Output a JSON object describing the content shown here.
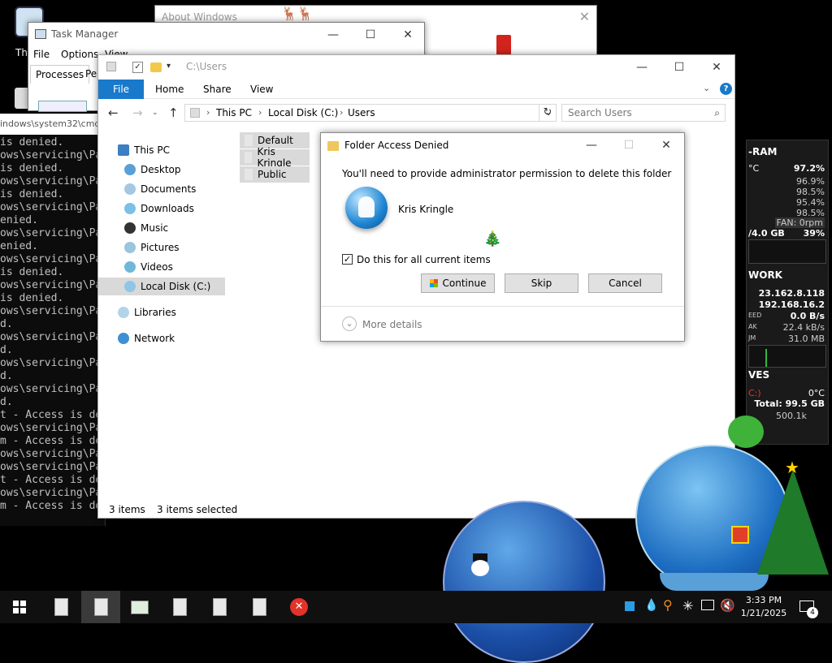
{
  "desktop": {
    "icon_label_partial": "Th"
  },
  "about": {
    "title": "About Windows"
  },
  "taskmgr": {
    "title": "Task Manager",
    "menus": [
      "File",
      "Options",
      "View"
    ],
    "tab_processes": "Processes",
    "tab_partial": "Pe"
  },
  "cmd": {
    "title_partial": "indows\\system32\\cmd",
    "lines": [
      "is denied.",
      "ows\\servicing\\Pa",
      "is denied.",
      "ows\\servicing\\Pa",
      "is denied.",
      "ows\\servicing\\Pa",
      "enied.",
      "ows\\servicing\\Pa",
      "enied.",
      "ows\\servicing\\Pa",
      "is denied.",
      "ows\\servicing\\Pa",
      "is denied.",
      "ows\\servicing\\Pa",
      "d.",
      "ows\\servicing\\Pa",
      "d.",
      "ows\\servicing\\Pa",
      "d.",
      "ows\\servicing\\Pa",
      "d.",
      "t - Access is de",
      "ows\\servicing\\Pa",
      "m - Access is de",
      "ows\\servicing\\Pa",
      "ows\\servicing\\Pa",
      "t - Access is de",
      "ows\\servicing\\Pa",
      "m - Access is de"
    ]
  },
  "explorer": {
    "path_title": "C:\\Users",
    "ribbon_tabs": [
      "File",
      "Home",
      "Share",
      "View"
    ],
    "breadcrumb": [
      "This PC",
      "Local Disk (C:)",
      "Users"
    ],
    "search_placeholder": "Search Users",
    "nav": [
      "This PC",
      "Desktop",
      "Documents",
      "Downloads",
      "Music",
      "Pictures",
      "Videos",
      "Local Disk (C:)",
      "Libraries",
      "Network"
    ],
    "files": [
      "Default",
      "Kris Kringle",
      "Public"
    ],
    "status_count": "3 items",
    "status_selected": "3 items selected"
  },
  "dialog": {
    "title": "Folder Access Denied",
    "message": "You'll need to provide administrator permission to delete this folder",
    "user_name": "Kris Kringle",
    "checkbox_label": "Do this for all current items",
    "checkbox_checked": true,
    "continue_label": "Continue",
    "skip_label": "Skip",
    "cancel_label": "Cancel",
    "more_details": "More details"
  },
  "gadget": {
    "ram_title": "-RAM",
    "cpu_prefix": "°C",
    "cpu_total": "97.2%",
    "cores": [
      "96.9%",
      "98.5%",
      "95.4%",
      "98.5%"
    ],
    "fan": "FAN: 0rpm",
    "mem": "/4.0 GB",
    "mem_pct": "39%",
    "net_title": "WORK",
    "ip1": "23.162.8.118",
    "ip2": "192.168.16.2",
    "speed_label": "EED",
    "speed_value": "0.0 B/s",
    "peak_label": "AK",
    "peak_value": "22.4 kB/s",
    "sum_label": "JM",
    "sum_value": "31.0 MB",
    "drives_title": "VES",
    "drive_label": "C:)",
    "drive_temp": "0°C",
    "drive_total": "Total: 99.5 GB",
    "drive_rate": "500.1k"
  },
  "taskbar": {
    "time": "3:33 PM",
    "date": "1/21/2025",
    "notif_count": "4"
  },
  "colors": {
    "accent": "#1979ca",
    "taskbar": "#101010",
    "gadget_bg": "#1a1a1a"
  }
}
